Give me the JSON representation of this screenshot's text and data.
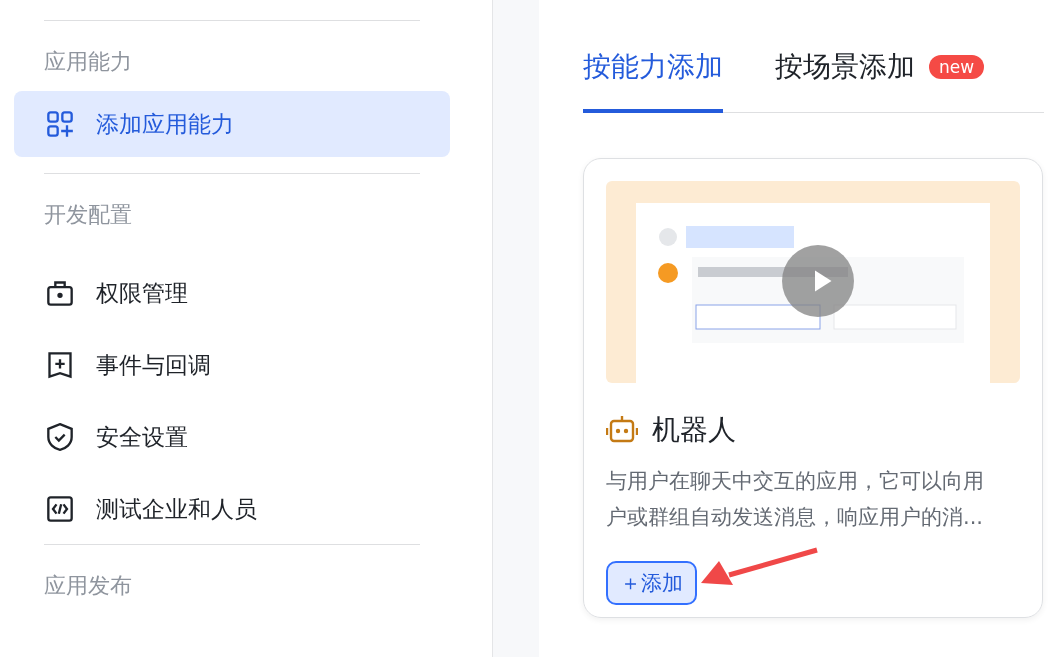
{
  "sidebar": {
    "sections": [
      {
        "title": "应用能力",
        "items": [
          {
            "label": "添加应用能力",
            "selected": true
          }
        ]
      },
      {
        "title": "开发配置",
        "items": [
          {
            "label": "权限管理",
            "selected": false
          },
          {
            "label": "事件与回调",
            "selected": false
          },
          {
            "label": "安全设置",
            "selected": false
          },
          {
            "label": "测试企业和人员",
            "selected": false
          }
        ]
      },
      {
        "title": "应用发布"
      }
    ]
  },
  "tabs": [
    {
      "label": "按能力添加",
      "selected": true
    },
    {
      "label": "按场景添加",
      "selected": false,
      "badge": "new"
    }
  ],
  "card": {
    "title": "机器人",
    "description": "与用户在聊天中交互的应用，它可以向用户或群组自动发送消息，响应用户的消...",
    "add_button": "＋添加"
  }
}
